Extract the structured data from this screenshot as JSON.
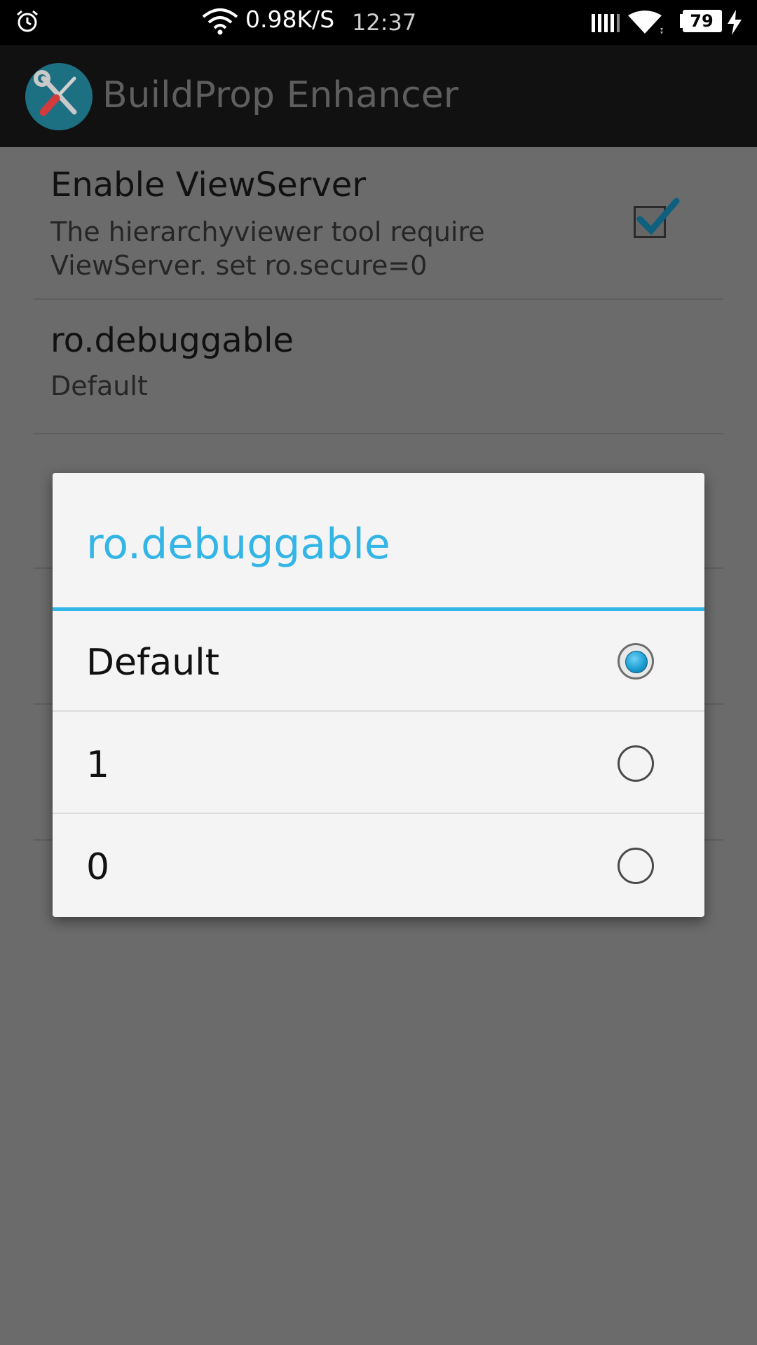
{
  "status_bar": {
    "network_speed": "0.98K/S",
    "time": "12:37",
    "battery_level": "79",
    "icons": [
      "alarm-icon",
      "wifi-icon",
      "signal-icon",
      "wifi-icon",
      "battery-icon",
      "charging-icon"
    ]
  },
  "action_bar": {
    "title": "BuildProp Enhancer",
    "icon": "wrench-screwdriver-icon"
  },
  "preferences": [
    {
      "title": "Enable ViewServer",
      "summary_line1": "The hierarchyviewer tool require",
      "summary_line2": "ViewServer. set ro.secure=0",
      "checked": true
    },
    {
      "title": "ro.debuggable",
      "summary": "Default"
    }
  ],
  "dialog": {
    "title": "ro.debuggable",
    "options": [
      {
        "label": "Default",
        "selected": true
      },
      {
        "label": "1",
        "selected": false
      },
      {
        "label": "0",
        "selected": false
      }
    ]
  },
  "colors": {
    "accent": "#33b5e5",
    "dim_background": "#6b6b6b",
    "dialog_background": "#f4f4f4",
    "action_bar": "#111111"
  }
}
